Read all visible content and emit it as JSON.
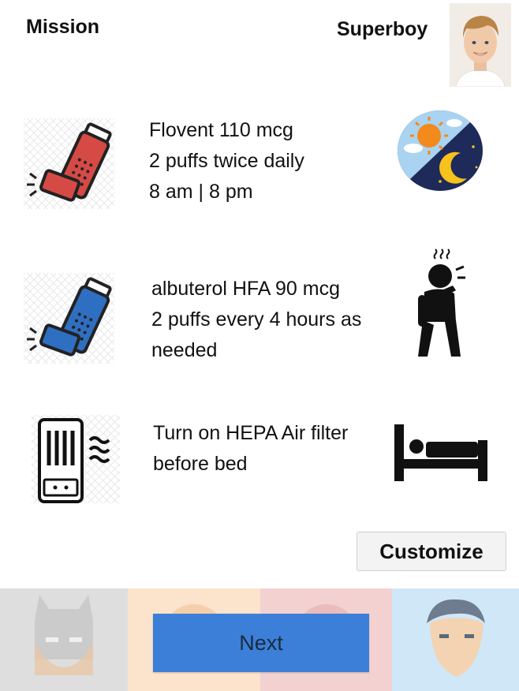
{
  "header": {
    "title": "Mission",
    "user_name": "Superboy"
  },
  "tasks": [
    {
      "lines": [
        "Flovent 110 mcg",
        "2 puffs twice daily",
        "8 am | 8 pm"
      ],
      "icon": "red-inhaler-icon",
      "indicator": "day-night-icon"
    },
    {
      "lines": [
        "albuterol HFA 90 mcg",
        "2 puffs every 4 hours as",
        "needed"
      ],
      "icon": "blue-inhaler-icon",
      "indicator": "coughing-person-icon"
    },
    {
      "lines": [
        "Turn on HEPA Air filter",
        "before bed"
      ],
      "icon": "air-purifier-icon",
      "indicator": "bed-icon"
    }
  ],
  "actions": {
    "customize": "Customize",
    "next": "Next"
  },
  "footer": {
    "heroes": [
      "batman-icon",
      "hero-icon-2",
      "hero-icon-3",
      "superman-icon"
    ]
  },
  "colors": {
    "red_inhaler": "#d64a45",
    "blue_inhaler": "#2f6fc1",
    "next_button": "#3b7fd9",
    "panel_1": "#dedede",
    "panel_2": "#fbe3cc",
    "panel_3": "#f3d1d1",
    "panel_4": "#cfe7f7"
  }
}
